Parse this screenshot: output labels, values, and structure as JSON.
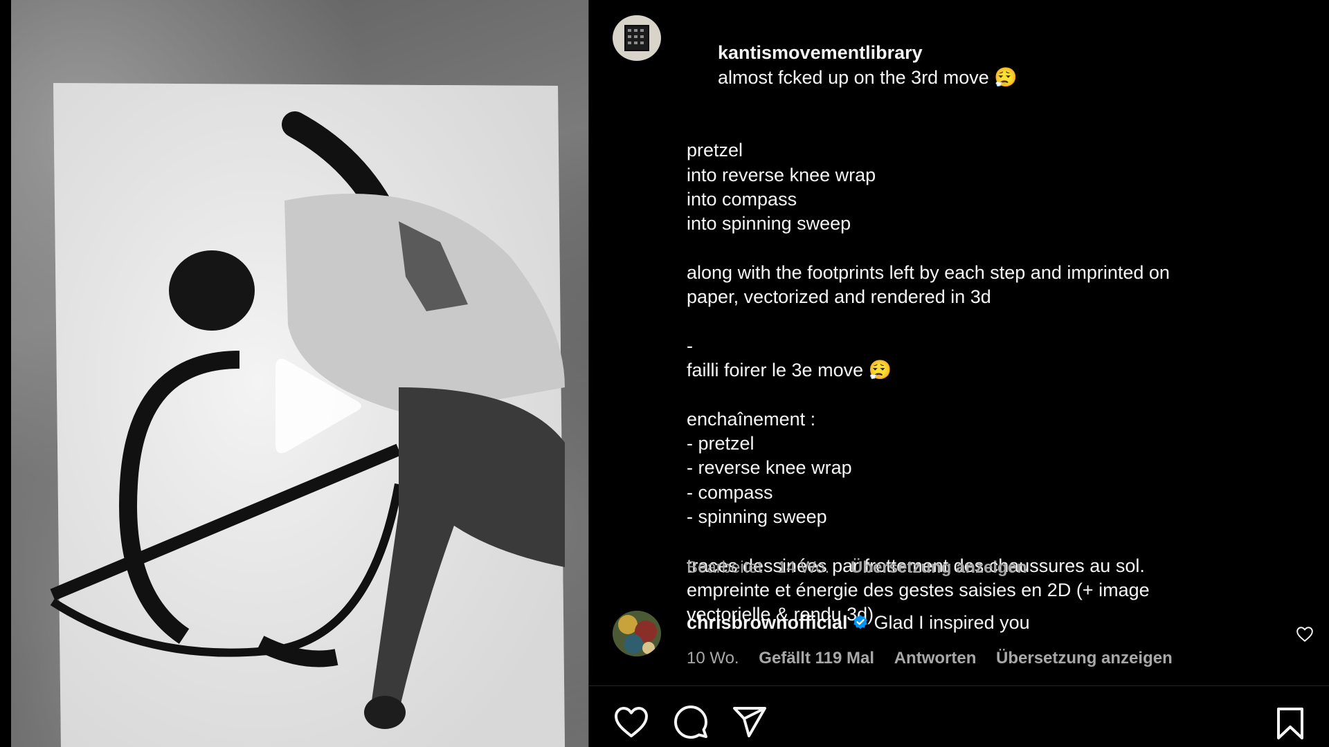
{
  "post": {
    "author_username": "kantismovementlibrary",
    "caption_first_line": "almost fcked up on the 3rd move 😮‍💨",
    "caption_lines": [
      "",
      "pretzel",
      "into reverse knee wrap",
      "into compass",
      "into spinning sweep",
      "",
      "along with the footprints left by each step and imprinted on",
      "paper, vectorized and rendered in 3d",
      "",
      "-",
      "failli foirer le 3e move 😮‍💨",
      "",
      "enchaînement :",
      "- pretzel",
      "- reverse knee wrap",
      "- compass",
      "- spinning sweep",
      "",
      "traces dessinées par frottement des chaussures au sol.",
      "empreinte et énergie des gestes saisies en 2D (+ image",
      "vectorielle & rendu 3d)"
    ],
    "meta": {
      "edited_time": "Bearbeitet · 14 Wo.",
      "translate_label": "Übersetzung anzeigen"
    }
  },
  "comment": {
    "username": "chrisbrownofficial",
    "verified": true,
    "text": "Glad I inspired you",
    "time": "10 Wo.",
    "likes_label": "Gefällt 119 Mal",
    "reply_label": "Antworten",
    "translate_label": "Übersetzung anzeigen"
  },
  "actions": {
    "like": "heart-icon",
    "comment": "comment-bubble-icon",
    "share": "paper-plane-icon",
    "save": "bookmark-icon"
  },
  "media": {
    "type": "video",
    "state": "paused",
    "play_icon": "play-icon"
  },
  "colors": {
    "background": "#000000",
    "text_primary": "#f5f5f5",
    "text_secondary": "#a8a8a8",
    "verified_badge": "#0095f6",
    "divider": "#262626"
  }
}
